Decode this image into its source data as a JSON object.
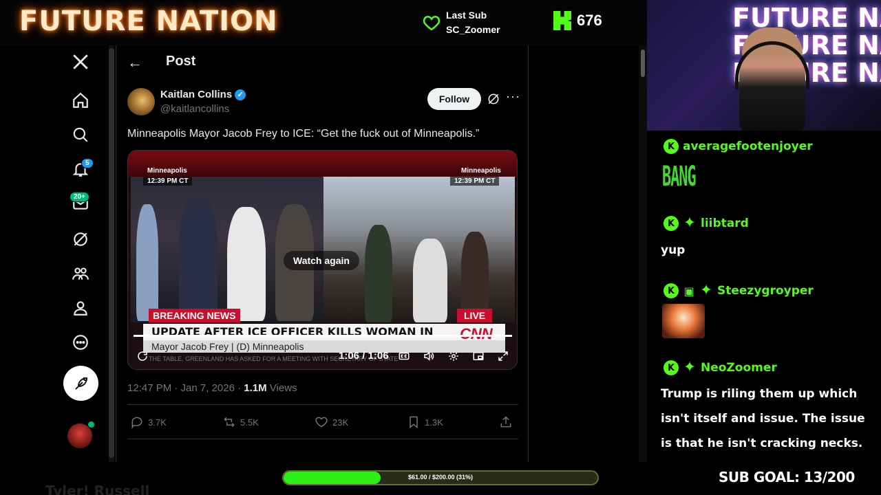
{
  "stream": {
    "brand_title": "FUTURE NATION",
    "last_sub_label": "Last Sub",
    "last_sub_name": "SC_Zoomer",
    "kick_viewer_count": "676",
    "accent_color": "#53fc18",
    "webcam_sign_lines": [
      "FUTURE NATION",
      "FUTURE NATION",
      "FUTURE NATION"
    ],
    "bottom_name": "Tyler! Russell",
    "goal_text": "$61.00 / $200.00 (31%)",
    "goal_progress": 0.31,
    "sub_goal": "SUB GOAL: 13/200"
  },
  "nav": {
    "items": [
      {
        "name": "x-logo-icon"
      },
      {
        "name": "home-icon"
      },
      {
        "name": "search-icon"
      },
      {
        "name": "notifications-icon",
        "badge": "5"
      },
      {
        "name": "messages-icon",
        "badge": "20+"
      },
      {
        "name": "grok-icon"
      },
      {
        "name": "communities-icon"
      },
      {
        "name": "profile-icon"
      },
      {
        "name": "more-icon"
      }
    ]
  },
  "post": {
    "header_title": "Post",
    "author_name": "Kaitlan Collins",
    "author_handle": "@kaitlancollins",
    "follow_label": "Follow",
    "text": "Minneapolis Mayor Jacob Frey to ICE: “Get the fuck out of Minneapolis.”",
    "timestamp": "12:47 PM · Jan 7, 2026 · ",
    "views_count": "1.1M",
    "views_label": " Views",
    "replies": "3.7K",
    "reposts": "5.5K",
    "likes": "23K",
    "bookmarks": "1.3K"
  },
  "video": {
    "loc_left": "Minneapolis",
    "time_left": "12:39 PM CT",
    "loc_right": "Minneapolis",
    "time_right": "12:39 PM CT",
    "watch_again": "Watch again",
    "breaking": "BREAKING NEWS",
    "live": "LIVE",
    "headline": "UPDATE AFTER ICE OFFICER KILLS WOMAN IN MINNEAPOLIS",
    "network": "CNN",
    "subline": "Mayor Jacob Frey  |  (D) Minneapolis",
    "ticker": "THE TABLE. GREENLAND HAS ASKED FOR A MEETING WITH SECRETARY OF STATE",
    "time": "1:06 / 1:06"
  },
  "chat": {
    "messages": [
      {
        "user": "averagefootenjoyer",
        "text": "BANG"
      },
      {
        "user": "liibtard",
        "text": "yup"
      },
      {
        "user": "Steezygroyper",
        "text": ""
      },
      {
        "user": "NeoZoomer",
        "text": "Trump is riling them up which isn't itself and issue. The issue is that he isn't cracking necks."
      }
    ]
  }
}
